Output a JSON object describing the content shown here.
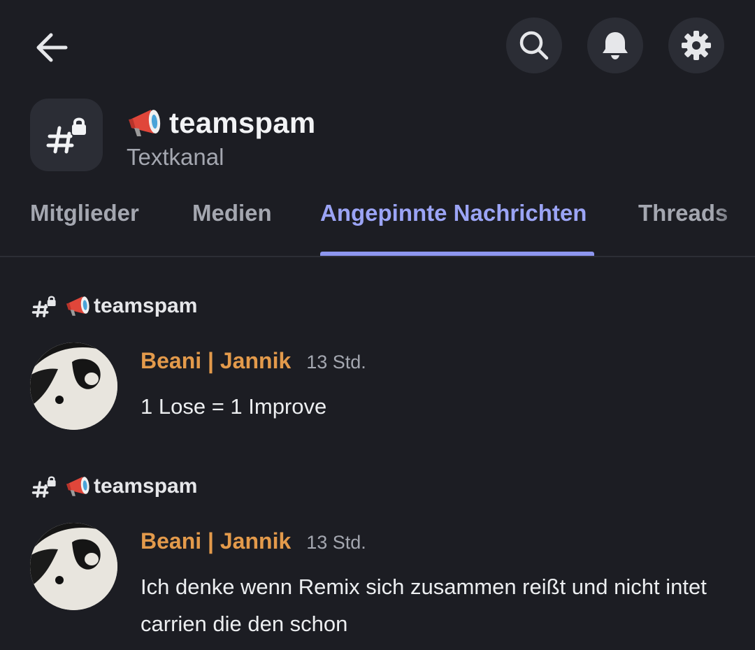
{
  "header": {
    "channel_name": "teamspam",
    "channel_type": "Textkanal"
  },
  "icons": {
    "back": "arrow-left-icon",
    "search": "search-icon",
    "notifications": "bell-icon",
    "settings": "gear-icon",
    "channel": "locked-hashtag-icon",
    "prefix": "megaphone-emoji"
  },
  "tabs": [
    {
      "label": "Mitglieder",
      "active": false
    },
    {
      "label": "Medien",
      "active": false
    },
    {
      "label": "Angepinnte Nachrichten",
      "active": true
    },
    {
      "label": "Threads",
      "active": false
    }
  ],
  "pinned_messages": [
    {
      "channel": "teamspam",
      "author": "Beani | Jannik",
      "time": "13 Std.",
      "text": "1 Lose = 1 Improve"
    },
    {
      "channel": "teamspam",
      "author": "Beani | Jannik",
      "time": "13 Std.",
      "text": "Ich denke wenn Remix sich zusammen reißt und nicht intet carrien die den schon"
    }
  ],
  "colors": {
    "background": "#1c1d23",
    "button_bg": "#2b2d35",
    "accent": "#9ba4f5",
    "author": "#e39a4b",
    "muted": "#a4a7b0"
  }
}
